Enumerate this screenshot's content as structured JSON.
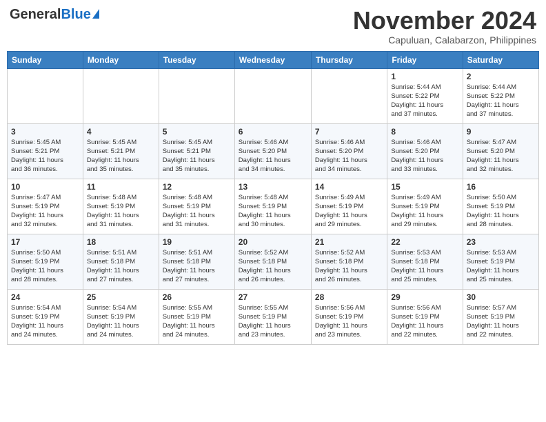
{
  "header": {
    "logo_general": "General",
    "logo_blue": "Blue",
    "month_title": "November 2024",
    "location": "Capuluan, Calabarzon, Philippines"
  },
  "weekdays": [
    "Sunday",
    "Monday",
    "Tuesday",
    "Wednesday",
    "Thursday",
    "Friday",
    "Saturday"
  ],
  "weeks": [
    [
      {
        "day": "",
        "info": ""
      },
      {
        "day": "",
        "info": ""
      },
      {
        "day": "",
        "info": ""
      },
      {
        "day": "",
        "info": ""
      },
      {
        "day": "",
        "info": ""
      },
      {
        "day": "1",
        "info": "Sunrise: 5:44 AM\nSunset: 5:22 PM\nDaylight: 11 hours\nand 37 minutes."
      },
      {
        "day": "2",
        "info": "Sunrise: 5:44 AM\nSunset: 5:22 PM\nDaylight: 11 hours\nand 37 minutes."
      }
    ],
    [
      {
        "day": "3",
        "info": "Sunrise: 5:45 AM\nSunset: 5:21 PM\nDaylight: 11 hours\nand 36 minutes."
      },
      {
        "day": "4",
        "info": "Sunrise: 5:45 AM\nSunset: 5:21 PM\nDaylight: 11 hours\nand 35 minutes."
      },
      {
        "day": "5",
        "info": "Sunrise: 5:45 AM\nSunset: 5:21 PM\nDaylight: 11 hours\nand 35 minutes."
      },
      {
        "day": "6",
        "info": "Sunrise: 5:46 AM\nSunset: 5:20 PM\nDaylight: 11 hours\nand 34 minutes."
      },
      {
        "day": "7",
        "info": "Sunrise: 5:46 AM\nSunset: 5:20 PM\nDaylight: 11 hours\nand 34 minutes."
      },
      {
        "day": "8",
        "info": "Sunrise: 5:46 AM\nSunset: 5:20 PM\nDaylight: 11 hours\nand 33 minutes."
      },
      {
        "day": "9",
        "info": "Sunrise: 5:47 AM\nSunset: 5:20 PM\nDaylight: 11 hours\nand 32 minutes."
      }
    ],
    [
      {
        "day": "10",
        "info": "Sunrise: 5:47 AM\nSunset: 5:19 PM\nDaylight: 11 hours\nand 32 minutes."
      },
      {
        "day": "11",
        "info": "Sunrise: 5:48 AM\nSunset: 5:19 PM\nDaylight: 11 hours\nand 31 minutes."
      },
      {
        "day": "12",
        "info": "Sunrise: 5:48 AM\nSunset: 5:19 PM\nDaylight: 11 hours\nand 31 minutes."
      },
      {
        "day": "13",
        "info": "Sunrise: 5:48 AM\nSunset: 5:19 PM\nDaylight: 11 hours\nand 30 minutes."
      },
      {
        "day": "14",
        "info": "Sunrise: 5:49 AM\nSunset: 5:19 PM\nDaylight: 11 hours\nand 29 minutes."
      },
      {
        "day": "15",
        "info": "Sunrise: 5:49 AM\nSunset: 5:19 PM\nDaylight: 11 hours\nand 29 minutes."
      },
      {
        "day": "16",
        "info": "Sunrise: 5:50 AM\nSunset: 5:19 PM\nDaylight: 11 hours\nand 28 minutes."
      }
    ],
    [
      {
        "day": "17",
        "info": "Sunrise: 5:50 AM\nSunset: 5:19 PM\nDaylight: 11 hours\nand 28 minutes."
      },
      {
        "day": "18",
        "info": "Sunrise: 5:51 AM\nSunset: 5:18 PM\nDaylight: 11 hours\nand 27 minutes."
      },
      {
        "day": "19",
        "info": "Sunrise: 5:51 AM\nSunset: 5:18 PM\nDaylight: 11 hours\nand 27 minutes."
      },
      {
        "day": "20",
        "info": "Sunrise: 5:52 AM\nSunset: 5:18 PM\nDaylight: 11 hours\nand 26 minutes."
      },
      {
        "day": "21",
        "info": "Sunrise: 5:52 AM\nSunset: 5:18 PM\nDaylight: 11 hours\nand 26 minutes."
      },
      {
        "day": "22",
        "info": "Sunrise: 5:53 AM\nSunset: 5:18 PM\nDaylight: 11 hours\nand 25 minutes."
      },
      {
        "day": "23",
        "info": "Sunrise: 5:53 AM\nSunset: 5:19 PM\nDaylight: 11 hours\nand 25 minutes."
      }
    ],
    [
      {
        "day": "24",
        "info": "Sunrise: 5:54 AM\nSunset: 5:19 PM\nDaylight: 11 hours\nand 24 minutes."
      },
      {
        "day": "25",
        "info": "Sunrise: 5:54 AM\nSunset: 5:19 PM\nDaylight: 11 hours\nand 24 minutes."
      },
      {
        "day": "26",
        "info": "Sunrise: 5:55 AM\nSunset: 5:19 PM\nDaylight: 11 hours\nand 24 minutes."
      },
      {
        "day": "27",
        "info": "Sunrise: 5:55 AM\nSunset: 5:19 PM\nDaylight: 11 hours\nand 23 minutes."
      },
      {
        "day": "28",
        "info": "Sunrise: 5:56 AM\nSunset: 5:19 PM\nDaylight: 11 hours\nand 23 minutes."
      },
      {
        "day": "29",
        "info": "Sunrise: 5:56 AM\nSunset: 5:19 PM\nDaylight: 11 hours\nand 22 minutes."
      },
      {
        "day": "30",
        "info": "Sunrise: 5:57 AM\nSunset: 5:19 PM\nDaylight: 11 hours\nand 22 minutes."
      }
    ]
  ]
}
